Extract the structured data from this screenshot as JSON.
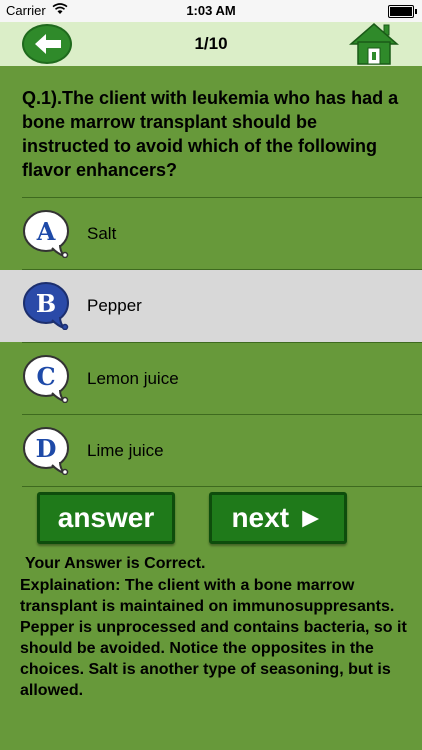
{
  "status_bar": {
    "carrier": "Carrier",
    "time": "1:03 AM"
  },
  "header": {
    "counter": "1/10"
  },
  "question": {
    "text": "Q.1).The client with leukemia who has had a bone marrow transplant should be instructed to avoid which of the following flavor enhancers?"
  },
  "options": [
    {
      "letter": "A",
      "label": "Salt",
      "selected": false
    },
    {
      "letter": "B",
      "label": "Pepper",
      "selected": true
    },
    {
      "letter": "C",
      "label": "Lemon juice",
      "selected": false
    },
    {
      "letter": "D",
      "label": "Lime juice",
      "selected": false
    }
  ],
  "buttons": {
    "answer": "answer",
    "next": "next ►"
  },
  "result": {
    "status": "Your Answer is Correct.",
    "explanation": "Explaination: The client with a bone marrow transplant is maintained on immunosuppresants. Pepper is unprocessed and contains bacteria, so it should be avoided. Notice the opposites in the choices. Salt is another type of seasoning, but is allowed."
  },
  "colors": {
    "background": "#67993a",
    "header": "#dbeec8",
    "button": "#1f7a1a",
    "selected_bubble": "#2a4aa8"
  }
}
